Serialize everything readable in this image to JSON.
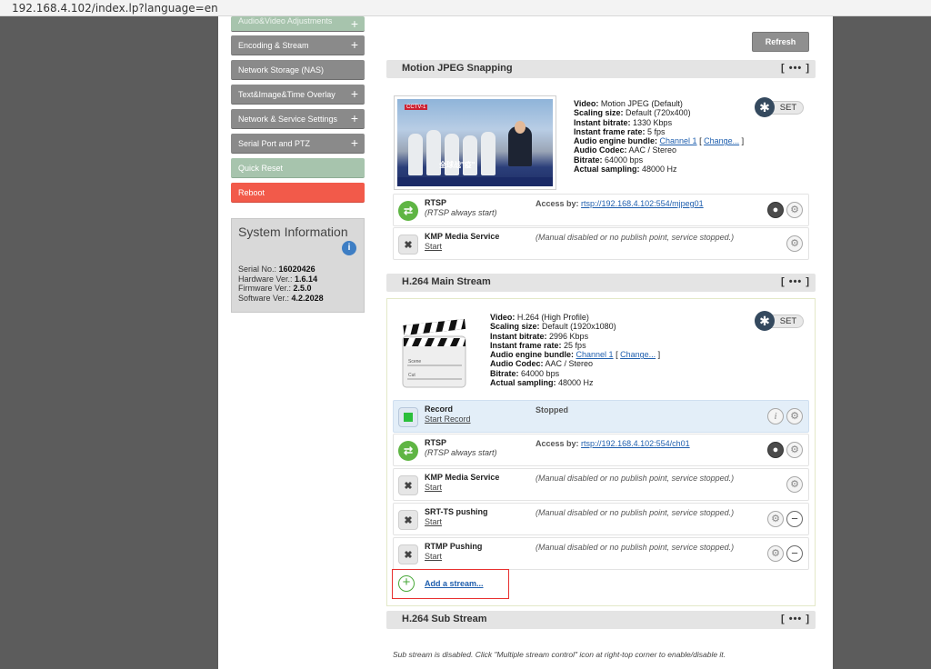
{
  "browser": {
    "url": "192.168.4.102/index.lp?language=en"
  },
  "sidebar": {
    "items": [
      {
        "label": "Audio&Video Adjustments",
        "plus": "+"
      },
      {
        "label": "Encoding & Stream",
        "plus": "+"
      },
      {
        "label": "Network Storage (NAS)"
      },
      {
        "label": "Text&Image&Time Overlay",
        "plus": "+"
      },
      {
        "label": "Network & Service Settings",
        "plus": "+"
      },
      {
        "label": "Serial Port and PTZ",
        "plus": "+"
      },
      {
        "label": "Quick Reset"
      },
      {
        "label": "Reboot"
      }
    ],
    "system_info": {
      "title": "System Information",
      "info_icon": "i",
      "serial_label": "Serial No.:",
      "serial": "16020426",
      "hardware_label": "Hardware Ver.:",
      "hardware": "1.6.14",
      "firmware_label": "Firmware Ver.:",
      "firmware": "2.5.0",
      "software_label": "Software Ver.:",
      "software": "4.2.2028"
    }
  },
  "toolbar": {
    "refresh_label": "Refresh"
  },
  "sections": {
    "mjpeg": {
      "title": "Motion JPEG Snapping",
      "menu": "[ ••• ]",
      "thumb": {
        "logo": "CCTV-1",
        "caption": "全球战\"疫\""
      },
      "video_label": "Video:",
      "video": "Motion JPEG (Default)",
      "scaling_label": "Scaling size:",
      "scaling": "Default (720x400)",
      "bitrate_label": "Instant bitrate:",
      "bitrate": "1330 Kbps",
      "framerate_label": "Instant frame rate:",
      "framerate": "5 fps",
      "audio_bundle_label": "Audio engine bundle:",
      "audio_bundle": "Channel 1",
      "bracket_open": "[",
      "change_link": "Change...",
      "bracket_close": "]",
      "audio_codec_label": "Audio Codec:",
      "audio_codec": "AAC / Stereo",
      "audio_bitrate_label": "Bitrate:",
      "audio_bitrate": "64000 bps",
      "sampling_label": "Actual sampling:",
      "sampling": "48000 Hz",
      "set_label": "SET",
      "services": {
        "rtsp": {
          "name": "RTSP",
          "sub": "(RTSP always start)",
          "access_label": "Access by:",
          "access_url": "rtsp://192.168.4.102:554/mjpeg01"
        },
        "kmp": {
          "name": "KMP Media Service",
          "start": "Start",
          "status": "(Manual disabled or no publish point, service stopped.)"
        }
      }
    },
    "main": {
      "title": "H.264 Main Stream",
      "menu": "[ ••• ]",
      "clapper": {
        "scene": "Scene",
        "cut": "Cut"
      },
      "video_label": "Video:",
      "video": "H.264 (High Profile)",
      "scaling_label": "Scaling size:",
      "scaling": "Default (1920x1080)",
      "bitrate_label": "Instant bitrate:",
      "bitrate": "2996 Kbps",
      "framerate_label": "Instant frame rate:",
      "framerate": "25 fps",
      "audio_bundle_label": "Audio engine bundle:",
      "audio_bundle": "Channel 1",
      "bracket_open": "[",
      "change_link": "Change...",
      "bracket_close": "]",
      "audio_codec_label": "Audio Codec:",
      "audio_codec": "AAC / Stereo",
      "audio_bitrate_label": "Bitrate:",
      "audio_bitrate": "64000 bps",
      "sampling_label": "Actual sampling:",
      "sampling": "48000 Hz",
      "set_label": "SET",
      "services": {
        "record": {
          "name": "Record",
          "start": "Start Record",
          "status": "Stopped"
        },
        "rtsp": {
          "name": "RTSP",
          "sub": "(RTSP always start)",
          "access_label": "Access by:",
          "access_url": "rtsp://192.168.4.102:554/ch01"
        },
        "kmp": {
          "name": "KMP Media Service",
          "start": "Start",
          "status": "(Manual disabled or no publish point, service stopped.)"
        },
        "srt": {
          "name": "SRT-TS pushing",
          "start": "Start",
          "status": "(Manual disabled or no publish point, service stopped.)"
        },
        "rtmp": {
          "name": "RTMP Pushing",
          "start": "Start",
          "status": "(Manual disabled or no publish point, service stopped.)"
        }
      },
      "add_stream": "Add a stream..."
    },
    "sub": {
      "title": "H.264 Sub Stream",
      "menu": "[ ••• ]",
      "note": "Sub stream is disabled. Click \"Multiple stream control\" icon at right-top corner to enable/disable it."
    }
  },
  "icons": {
    "gear": "⚙",
    "person": "●",
    "info": "i",
    "minus": "−",
    "switch": "⇄",
    "cross": "✖",
    "plus": "+",
    "set": "✱"
  },
  "colors": {
    "accent_green": "#5fb544",
    "reboot_red": "#f25a4a",
    "link_blue": "#1f5fae",
    "highlight_red": "#e8302f"
  }
}
